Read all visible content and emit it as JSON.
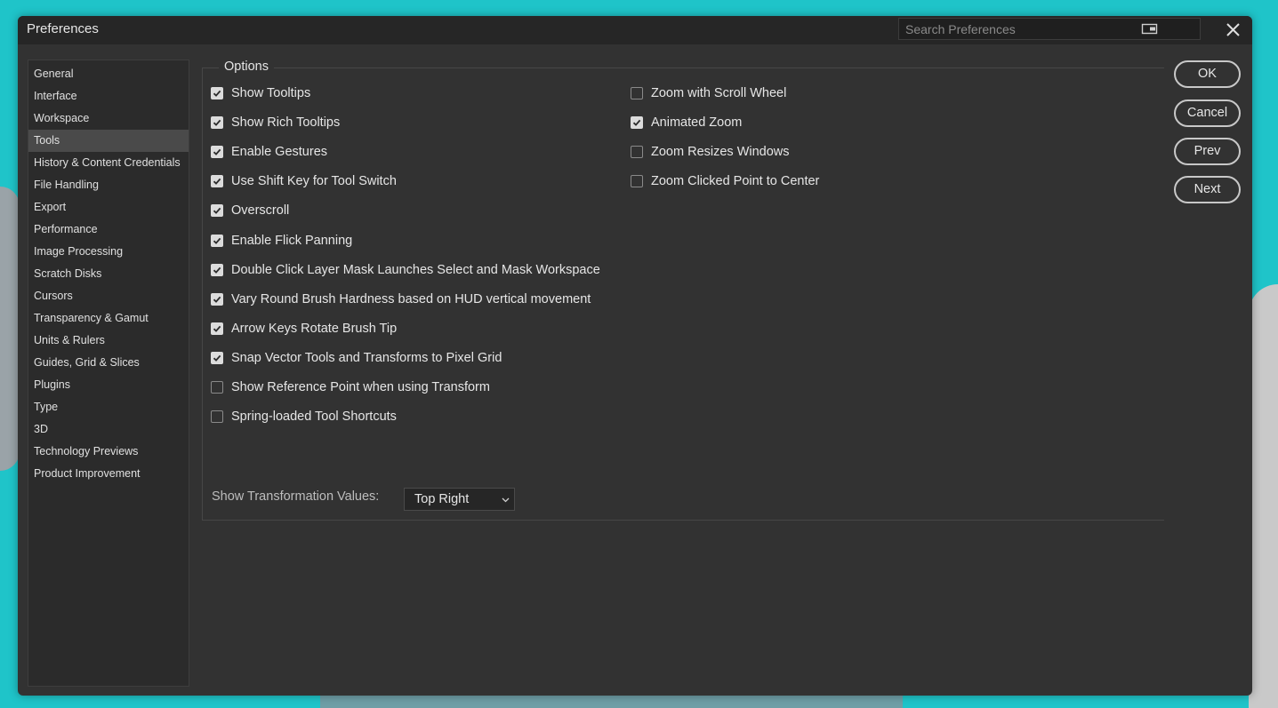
{
  "dialog": {
    "title": "Preferences",
    "search_placeholder": "Search Preferences"
  },
  "sidebar": {
    "items": [
      {
        "label": "General"
      },
      {
        "label": "Interface"
      },
      {
        "label": "Workspace"
      },
      {
        "label": "Tools",
        "selected": true
      },
      {
        "label": "History & Content Credentials"
      },
      {
        "label": "File Handling"
      },
      {
        "label": "Export"
      },
      {
        "label": "Performance"
      },
      {
        "label": "Image Processing"
      },
      {
        "label": "Scratch Disks"
      },
      {
        "label": "Cursors"
      },
      {
        "label": "Transparency & Gamut"
      },
      {
        "label": "Units & Rulers"
      },
      {
        "label": "Guides, Grid & Slices"
      },
      {
        "label": "Plugins"
      },
      {
        "label": "Type"
      },
      {
        "label": "3D"
      },
      {
        "label": "Technology Previews"
      },
      {
        "label": "Product Improvement"
      }
    ]
  },
  "options": {
    "legend": "Options",
    "left_column": [
      {
        "label": "Show Tooltips",
        "checked": true
      },
      {
        "label": "Show Rich Tooltips",
        "checked": true
      },
      {
        "label": "Enable Gestures",
        "checked": true
      },
      {
        "label": "Use Shift Key for Tool Switch",
        "checked": true
      },
      {
        "label": "Overscroll",
        "checked": true
      },
      {
        "label": "Enable Flick Panning",
        "checked": true
      },
      {
        "label": "Double Click Layer Mask Launches Select and Mask Workspace",
        "checked": true
      },
      {
        "label": "Vary Round Brush Hardness based on HUD vertical movement",
        "checked": true
      },
      {
        "label": "Arrow Keys Rotate Brush Tip",
        "checked": true
      },
      {
        "label": "Snap Vector Tools and Transforms to Pixel Grid",
        "checked": true
      },
      {
        "label": "Show Reference Point when using Transform",
        "checked": false
      },
      {
        "label": "Spring-loaded Tool Shortcuts",
        "checked": false
      }
    ],
    "right_column": [
      {
        "label": "Zoom with Scroll Wheel",
        "checked": false
      },
      {
        "label": "Animated Zoom",
        "checked": true
      },
      {
        "label": "Zoom Resizes Windows",
        "checked": false
      },
      {
        "label": "Zoom Clicked Point to Center",
        "checked": false
      }
    ],
    "transformation_values": {
      "label": "Show Transformation Values:",
      "selected": "Top Right"
    }
  },
  "buttons": {
    "ok": "OK",
    "cancel": "Cancel",
    "prev": "Prev",
    "next": "Next"
  },
  "colors": {
    "desktop": "#1fc4c9",
    "dialog_bg": "#323232",
    "titlebar_bg": "#262626",
    "sidebar_selected": "#4a4a4a"
  }
}
